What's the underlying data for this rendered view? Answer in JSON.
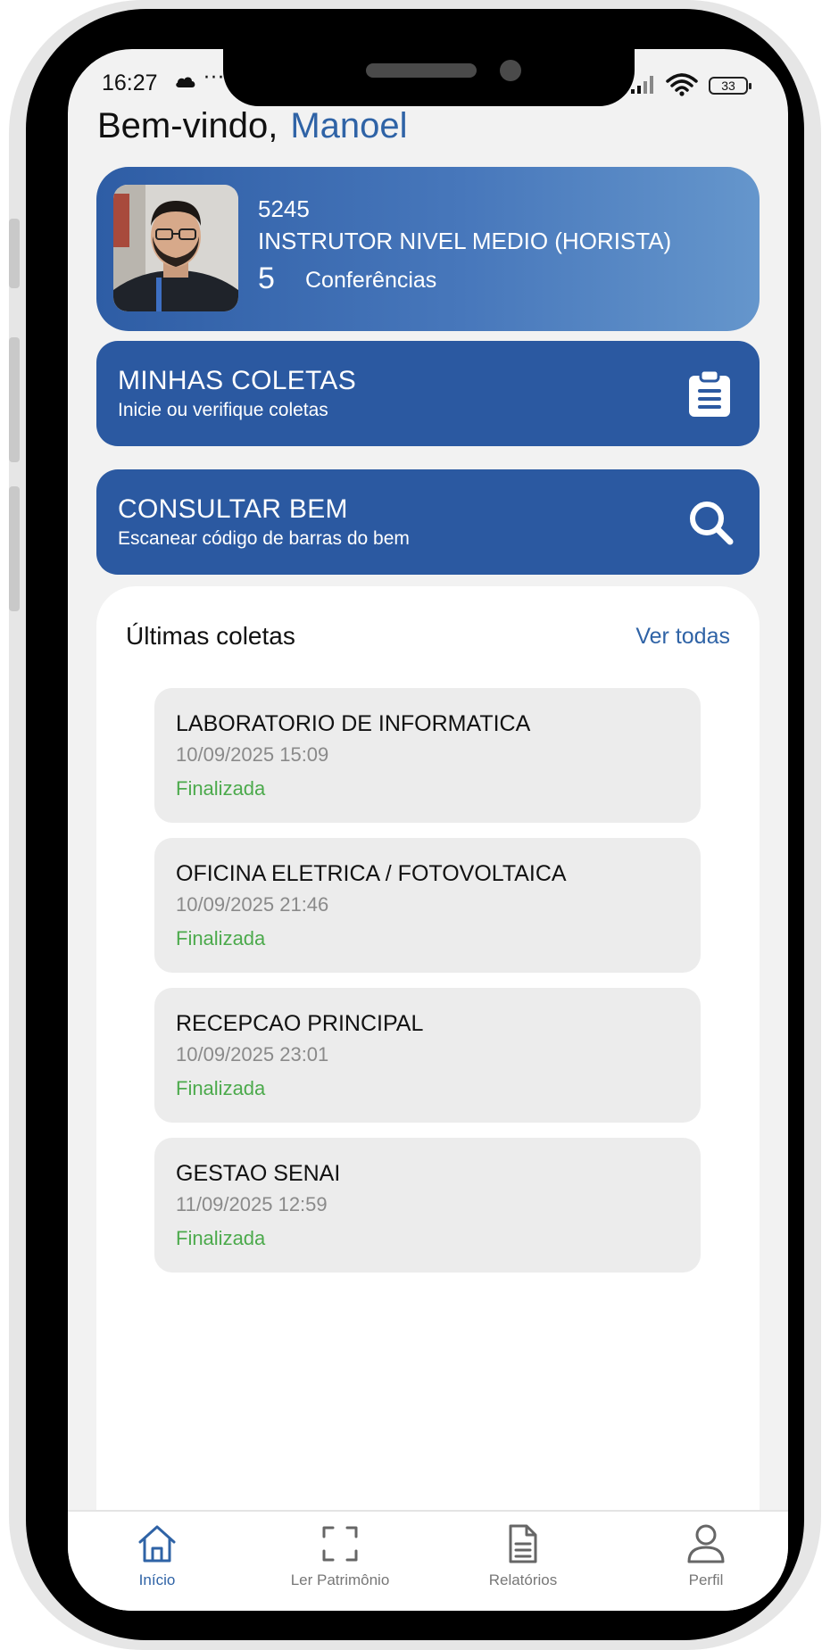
{
  "status_bar": {
    "time": "16:27",
    "dots": "···",
    "battery": "33"
  },
  "header": {
    "greeting": "Bem-vindo,",
    "user_name": "Manoel"
  },
  "profile": {
    "id": "5245",
    "role": "INSTRUTOR NIVEL MEDIO (HORISTA)",
    "count": "5",
    "count_label": "Conferências"
  },
  "actions": [
    {
      "title": "MINHAS COLETAS",
      "subtitle": "Inicie ou verifique coletas",
      "icon": "clipboard-icon"
    },
    {
      "title": "CONSULTAR BEM",
      "subtitle": "Escanear código de barras do bem",
      "icon": "search-icon"
    }
  ],
  "recent": {
    "title": "Últimas coletas",
    "see_all": "Ver todas",
    "items": [
      {
        "name": "LABORATORIO DE INFORMATICA",
        "date": "10/09/2025 15:09",
        "status": "Finalizada"
      },
      {
        "name": "OFICINA ELETRICA / FOTOVOLTAICA",
        "date": "10/09/2025 21:46",
        "status": "Finalizada"
      },
      {
        "name": "RECEPCAO PRINCIPAL",
        "date": "10/09/2025 23:01",
        "status": "Finalizada"
      },
      {
        "name": "GESTAO SENAI",
        "date": "11/09/2025 12:59",
        "status": "Finalizada"
      }
    ]
  },
  "nav": [
    {
      "label": "Início",
      "icon": "home-icon",
      "active": true
    },
    {
      "label": "Ler Patrimônio",
      "icon": "scan-icon",
      "active": false
    },
    {
      "label": "Relatórios",
      "icon": "document-icon",
      "active": false
    },
    {
      "label": "Perfil",
      "icon": "user-icon",
      "active": false
    }
  ],
  "colors": {
    "primary": "#2b59a1",
    "accent_text": "#2f63a6",
    "status_done": "#4caa4c",
    "screen_bg": "#f2f2f2"
  }
}
